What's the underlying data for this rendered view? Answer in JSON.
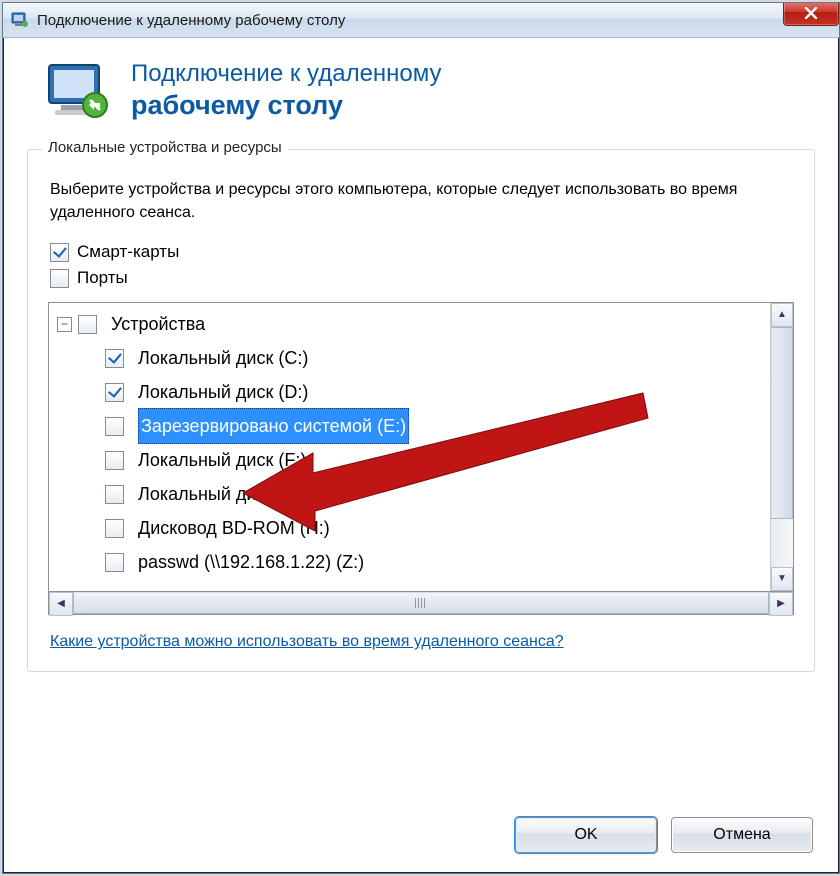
{
  "window": {
    "title": "Подключение к удаленному рабочему столу"
  },
  "header": {
    "line1": "Подключение к удаленному",
    "line2": "рабочему столу"
  },
  "group": {
    "legend": "Локальные устройства и ресурсы",
    "instructions": "Выберите устройства и ресурсы этого компьютера, которые следует использовать во время удаленного сеанса.",
    "smart_cards": {
      "label": "Смарт-карты",
      "checked": true
    },
    "ports": {
      "label": "Порты",
      "checked": false
    },
    "tree": {
      "root": {
        "label": "Устройства",
        "checked": false,
        "expanded": true
      },
      "items": [
        {
          "label": "Локальный диск (C:)",
          "checked": true,
          "selected": false
        },
        {
          "label": "Локальный диск (D:)",
          "checked": true,
          "selected": false
        },
        {
          "label": "Зарезервировано системой (E:)",
          "checked": false,
          "selected": true
        },
        {
          "label": "Локальный диск (F:)",
          "checked": false,
          "selected": false
        },
        {
          "label": "Локальный диск (G:)",
          "checked": false,
          "selected": false
        },
        {
          "label": "Дисковод BD-ROM (H:)",
          "checked": false,
          "selected": false
        },
        {
          "label": "passwd (\\\\192.168.1.22) (Z:)",
          "checked": false,
          "selected": false
        }
      ]
    },
    "help_link": "Какие устройства можно использовать во время удаленного сеанса?"
  },
  "buttons": {
    "ok": "OK",
    "cancel": "Отмена"
  }
}
